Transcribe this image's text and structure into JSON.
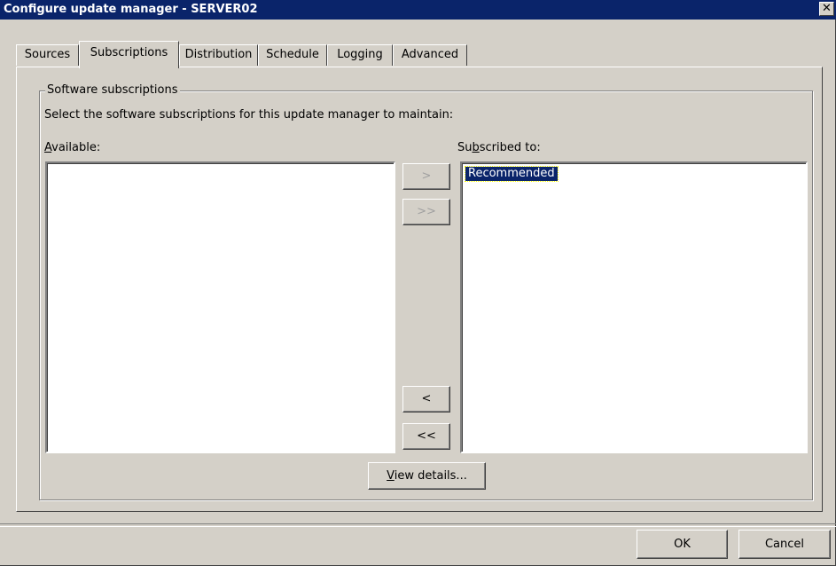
{
  "window": {
    "title": "Configure update manager - SERVER02"
  },
  "tabs": [
    {
      "label": "Sources"
    },
    {
      "label": "Subscriptions"
    },
    {
      "label": "Distribution"
    },
    {
      "label": "Schedule"
    },
    {
      "label": "Logging"
    },
    {
      "label": "Advanced"
    }
  ],
  "active_tab": "Subscriptions",
  "group": {
    "title": "Software subscriptions",
    "description": "Select the software subscriptions for this update manager to maintain:"
  },
  "available": {
    "label_prefix": "",
    "label_accel": "A",
    "label_rest": "vailable:",
    "items": []
  },
  "subscribed": {
    "label_prefix": "Su",
    "label_accel": "b",
    "label_rest": "scribed to:",
    "items": [
      "Recommended"
    ],
    "selected": "Recommended"
  },
  "transfer_buttons": {
    "add": ">",
    "add_all": ">>",
    "remove": "<",
    "remove_all": "<<"
  },
  "view_details": {
    "accel": "V",
    "rest": "iew details..."
  },
  "footer": {
    "ok": "OK",
    "cancel": "Cancel"
  }
}
